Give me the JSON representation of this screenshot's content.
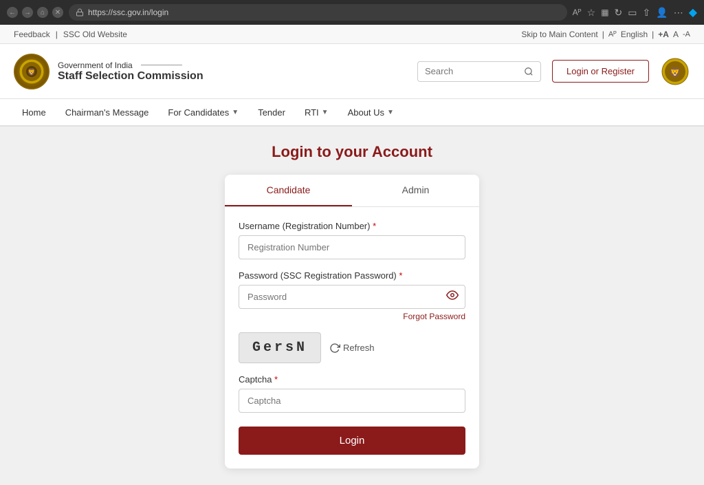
{
  "browser": {
    "url": "https://ssc.gov.in/login",
    "back_title": "back",
    "forward_title": "forward",
    "home_title": "home",
    "close_title": "close",
    "more_title": "more"
  },
  "utility": {
    "feedback_label": "Feedback",
    "separator": "|",
    "old_website_label": "SSC Old Website",
    "skip_main": "Skip to Main Content",
    "language_icon": "A",
    "language_label": "English",
    "text_size_large": "+A",
    "text_size_normal": "A",
    "text_size_small": "-A"
  },
  "header": {
    "gov_label": "Government of India",
    "org_label": "Staff Selection Commission",
    "search_placeholder": "Search",
    "login_register_label": "Login or Register"
  },
  "nav": {
    "items": [
      {
        "label": "Home",
        "has_dropdown": false
      },
      {
        "label": "Chairman's Message",
        "has_dropdown": false
      },
      {
        "label": "For Candidates",
        "has_dropdown": true
      },
      {
        "label": "Tender",
        "has_dropdown": false
      },
      {
        "label": "RTI",
        "has_dropdown": true
      },
      {
        "label": "About Us",
        "has_dropdown": true
      }
    ]
  },
  "main": {
    "page_title": "Login to your Account",
    "tabs": [
      {
        "label": "Candidate",
        "active": true
      },
      {
        "label": "Admin",
        "active": false
      }
    ],
    "form": {
      "username_label": "Username (Registration Number)",
      "username_placeholder": "Registration Number",
      "password_label": "Password (SSC Registration Password)",
      "password_placeholder": "Password",
      "forgot_password": "Forgot Password",
      "captcha_value": "GersN",
      "refresh_label": "Refresh",
      "captcha_label": "Captcha",
      "captcha_placeholder": "Captcha",
      "login_button": "Login",
      "required_marker": "*"
    }
  }
}
